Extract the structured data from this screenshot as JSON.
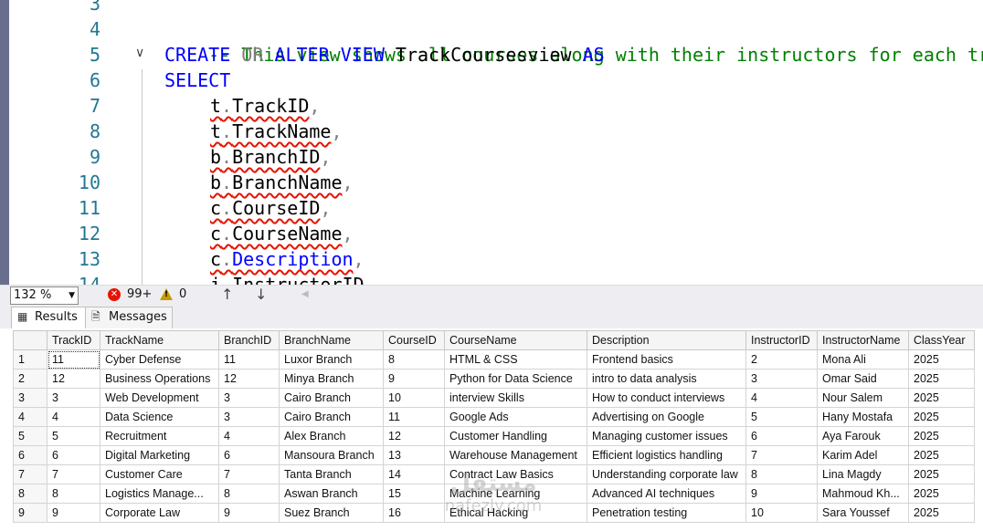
{
  "editor": {
    "line_numbers": [
      "3",
      "4",
      "5",
      "6",
      "7",
      "8",
      "9",
      "10",
      "11",
      "12",
      "13",
      "14"
    ],
    "comment": "-- This view shows all courses along with their instructors for each tra",
    "create_kw": "CREATE",
    "or_kw": "OR",
    "alter_kw": "ALTER",
    "view_kw": "VIEW",
    "view_name": "TrackCoursesview",
    "as_kw": "AS",
    "select_kw": "SELECT",
    "columns": [
      {
        "alias": "t",
        "field": "TrackID"
      },
      {
        "alias": "t",
        "field": "TrackName"
      },
      {
        "alias": "b",
        "field": "BranchID"
      },
      {
        "alias": "b",
        "field": "BranchName"
      },
      {
        "alias": "c",
        "field": "CourseID"
      },
      {
        "alias": "c",
        "field": "CourseName"
      },
      {
        "alias": "c",
        "field": "Description"
      },
      {
        "alias": "i",
        "field": "InstructorID"
      }
    ],
    "dot": ".",
    "comma": ","
  },
  "status": {
    "zoom": "132 %",
    "errors": "99+",
    "warnings": "0"
  },
  "tabs": {
    "results": "Results",
    "messages": "Messages"
  },
  "grid": {
    "columns": [
      "TrackID",
      "TrackName",
      "BranchID",
      "BranchName",
      "CourseID",
      "CourseName",
      "Description",
      "InstructorID",
      "InstructorName",
      "ClassYear"
    ],
    "rows": [
      [
        "1",
        "11",
        "Cyber Defense",
        "11",
        "Luxor Branch",
        "8",
        "HTML & CSS",
        "Frontend basics",
        "2",
        "Mona Ali",
        "2025"
      ],
      [
        "2",
        "12",
        "Business Operations",
        "12",
        "Minya Branch",
        "9",
        "Python for Data Science",
        "intro to data analysis",
        "3",
        "Omar Said",
        "2025"
      ],
      [
        "3",
        "3",
        "Web Development",
        "3",
        "Cairo Branch",
        "10",
        "interview Skills",
        "How to conduct interviews",
        "4",
        "Nour Salem",
        "2025"
      ],
      [
        "4",
        "4",
        "Data Science",
        "3",
        "Cairo Branch",
        "11",
        "Google Ads",
        "Advertising on Google",
        "5",
        "Hany Mostafa",
        "2025"
      ],
      [
        "5",
        "5",
        "Recruitment",
        "4",
        "Alex Branch",
        "12",
        "Customer Handling",
        "Managing customer issues",
        "6",
        "Aya Farouk",
        "2025"
      ],
      [
        "6",
        "6",
        "Digital Marketing",
        "6",
        "Mansoura Branch",
        "13",
        "Warehouse Management",
        "Efficient logistics handling",
        "7",
        "Karim Adel",
        "2025"
      ],
      [
        "7",
        "7",
        "Customer Care",
        "7",
        "Tanta Branch",
        "14",
        "Contract Law Basics",
        "Understanding corporate law",
        "8",
        "Lina Magdy",
        "2025"
      ],
      [
        "8",
        "8",
        "Logistics Manage...",
        "8",
        "Aswan Branch",
        "15",
        "Machine Learning",
        "Advanced AI techniques",
        "9",
        "Mahmoud Kh...",
        "2025"
      ],
      [
        "9",
        "9",
        "Corporate Law",
        "9",
        "Suez Branch",
        "16",
        "Ethical Hacking",
        "Penetration testing",
        "10",
        "Sara Youssef",
        "2025"
      ]
    ]
  },
  "watermark": {
    "logo": "مستقل",
    "text": "nafezly.com"
  },
  "colors": {
    "keyword": "#0000ff",
    "comment": "#008000",
    "line_number": "#237893",
    "squiggle": "#e51400"
  }
}
